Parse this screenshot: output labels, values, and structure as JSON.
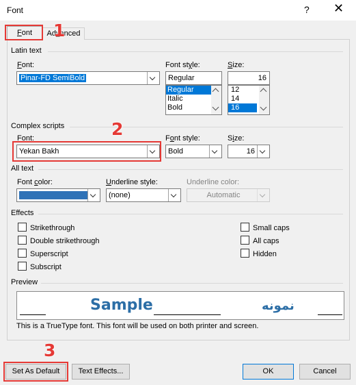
{
  "window": {
    "title": "Font",
    "help": "?",
    "close": "✕"
  },
  "tabs": [
    {
      "label": "Font",
      "accel": "F",
      "rest": "ont"
    },
    {
      "label": "Advanced",
      "pre": "Ad",
      "accel": "v",
      "rest": "anced"
    }
  ],
  "latin": {
    "group": "Latin text",
    "font_label_accel": "F",
    "font_label_rest": "ont:",
    "font_value": "Pinar-FD SemiBold",
    "style_label_pre": "Font st",
    "style_label_accel": "y",
    "style_label_rest": "le:",
    "style_value": "Regular",
    "style_options": [
      "Regular",
      "Italic",
      "Bold"
    ],
    "style_selected": 0,
    "size_label_accel": "S",
    "size_label_rest": "ize:",
    "size_value": "16",
    "size_options": [
      "12",
      "14",
      "16"
    ],
    "size_selected": 2
  },
  "complex": {
    "group": "Complex scripts",
    "font_label_pre": "F",
    "font_label_accel": "o",
    "font_label_rest": "nt:",
    "font_value": "Yekan Bakh",
    "style_label_pre": "F",
    "style_label_accel": "o",
    "style_label_rest": "nt style:",
    "style_value": "Bold",
    "size_label_pre": "S",
    "size_label_accel": "i",
    "size_label_rest": "ze:",
    "size_value": "16"
  },
  "all_text": {
    "group": "All text",
    "color_label_pre": "Font ",
    "color_label_accel": "c",
    "color_label_rest": "olor:",
    "color_hex": "#2f72b7",
    "underline_label_accel": "U",
    "underline_label_rest": "nderline style:",
    "underline_value": "(none)",
    "underline_color_label": "Underline color:",
    "underline_color_value": "Automatic"
  },
  "effects": {
    "group": "Effects",
    "left": [
      {
        "pre": "",
        "accel": "",
        "rest": "Strikethrough",
        "ul": "k",
        "text": "Strikethrough"
      },
      {
        "text": "Double strikethrough"
      },
      {
        "text": "Superscript"
      },
      {
        "text": "Subscript"
      }
    ],
    "right": [
      {
        "text": "Small caps"
      },
      {
        "text": "All caps"
      },
      {
        "text": "Hidden"
      }
    ]
  },
  "preview": {
    "group": "Preview",
    "latin_sample": "Sample",
    "complex_sample": "نمونه",
    "note": "This is a TrueType font. This font will be used on both printer and screen."
  },
  "buttons": {
    "default": "Set As Default",
    "text_effects": "Text Effects...",
    "ok": "OK",
    "cancel": "Cancel"
  },
  "steps": [
    "1",
    "2",
    "3"
  ],
  "highlight_color": "#e53935",
  "accent": "#0078d7"
}
